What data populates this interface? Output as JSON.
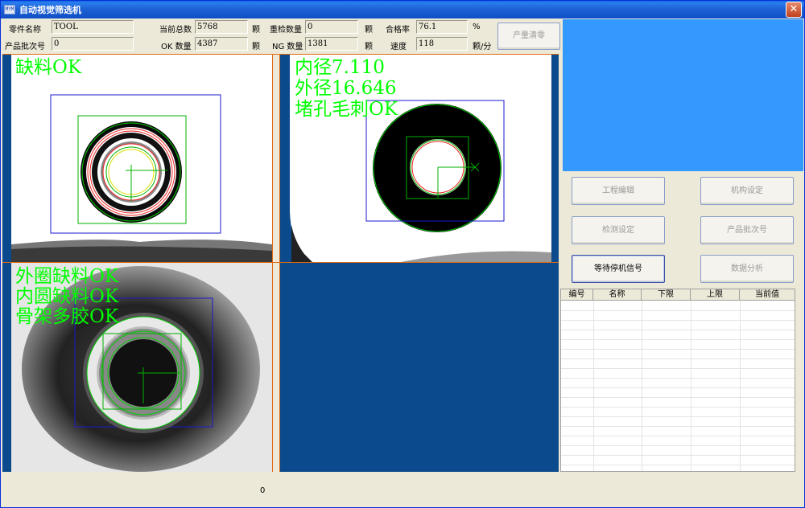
{
  "window": {
    "title": "自动视觉筛选机",
    "icon_label": "MYM"
  },
  "info": {
    "part_name_label": "零件名称",
    "part_name_value": "TOOL",
    "batch_label": "产品批次号",
    "batch_value": "0",
    "total_label": "当前总数",
    "total_value": "5768",
    "total_unit": "颗",
    "ok_label": "OK 数量",
    "ok_value": "4387",
    "ok_unit": "颗",
    "recheck_label": "重检数量",
    "recheck_value": "0",
    "recheck_unit": "颗",
    "ng_label": "NG 数量",
    "ng_value": "1381",
    "ng_unit": "颗",
    "pass_rate_label": "合格率",
    "pass_rate_value": "76.1",
    "pass_rate_unit": "%",
    "speed_label": "速度",
    "speed_value": "118",
    "speed_unit": "颗/分"
  },
  "buttons": {
    "clear_count": "产量清零",
    "project_edit": "工程编辑",
    "mechanism_setup": "机构设定",
    "detection_setup": "检测设定",
    "product_batch": "产品批次号",
    "wait_stop": "等待停机信号",
    "data_analysis": "数据分析"
  },
  "views": {
    "view1": {
      "lines": [
        "缺料OK"
      ]
    },
    "view2": {
      "lines": [
        "内径7.110",
        "外径16.646",
        "堵孔毛刺OK"
      ]
    },
    "view3": {
      "lines": [
        "外圈缺料OK",
        "内圆缺料OK",
        "骨架多胶OK"
      ]
    }
  },
  "table": {
    "columns": [
      "编号",
      "名称",
      "下限",
      "上限",
      "当前值"
    ],
    "rows": []
  },
  "status": {
    "value": "0"
  },
  "colors": {
    "overlay_text": "#00ff00",
    "camera_panel": "#3399ff",
    "empty_view": "#0b4a8c"
  }
}
